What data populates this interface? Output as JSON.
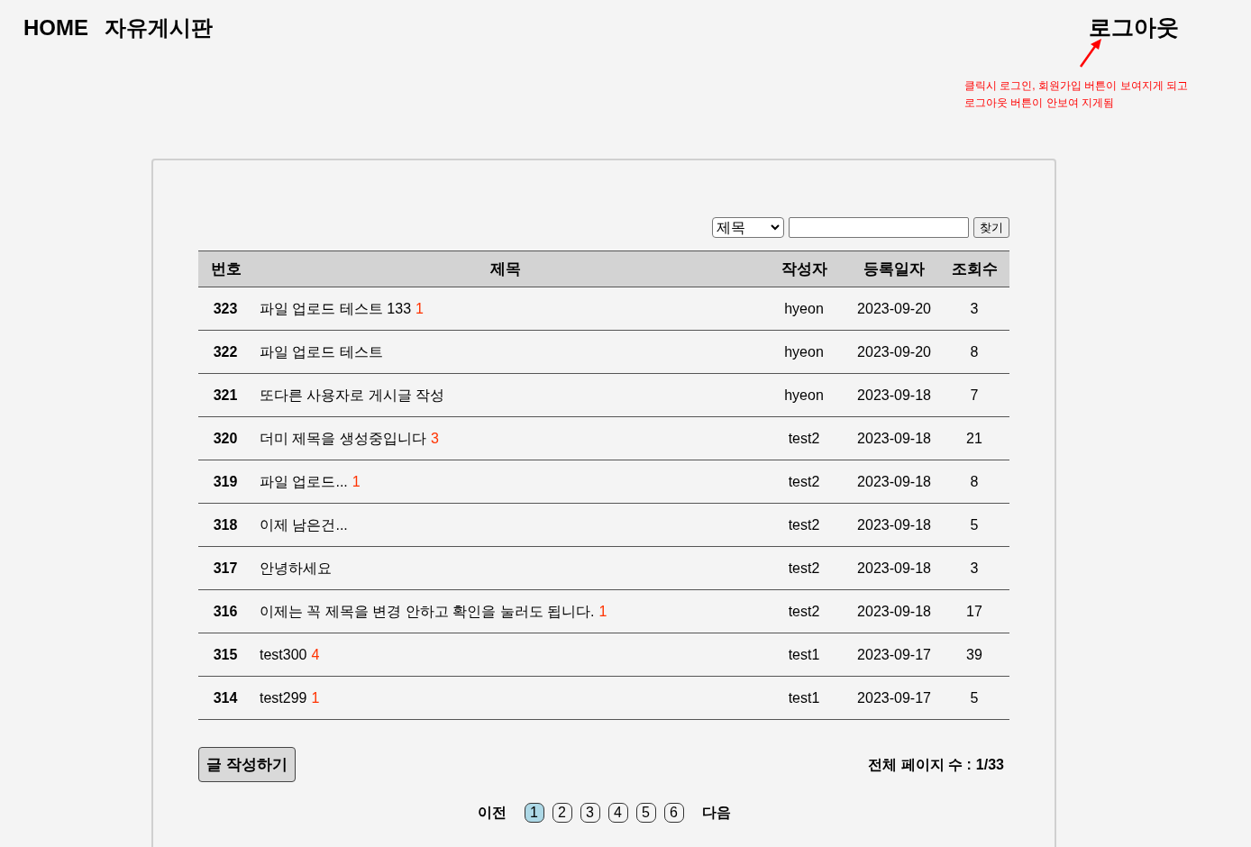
{
  "nav": {
    "home": "HOME",
    "board": "자유게시판",
    "logout": "로그아웃"
  },
  "annotation": {
    "lines": [
      "클릭시 로그인, 회원가입 버튼이 보여지게 되고",
      "로그아웃 버튼이 안보여 지게됨"
    ]
  },
  "search": {
    "option": "제목",
    "button": "찾기"
  },
  "table": {
    "columns": [
      "번호",
      "제목",
      "작성자",
      "등록일자",
      "조회수"
    ],
    "rows": [
      {
        "no": "323",
        "title": {
          "text": "파일 업로드 테스트 133",
          "comments": "1"
        },
        "author": "hyeon",
        "date": "2023-09-20",
        "views": "3"
      },
      {
        "no": "322",
        "title": {
          "text": "파일 업로드 테스트"
        },
        "author": "hyeon",
        "date": "2023-09-20",
        "views": "8"
      },
      {
        "no": "321",
        "title": {
          "text": "또다른 사용자로 게시글 작성"
        },
        "author": "hyeon",
        "date": "2023-09-18",
        "views": "7"
      },
      {
        "no": "320",
        "title": {
          "text": "더미 제목을 생성중입니다",
          "comments": "3"
        },
        "author": "test2",
        "date": "2023-09-18",
        "views": "21"
      },
      {
        "no": "319",
        "title": {
          "text": "파일 업로드...",
          "comments": "1"
        },
        "author": "test2",
        "date": "2023-09-18",
        "views": "8"
      },
      {
        "no": "318",
        "title": {
          "text": "이제 남은건..."
        },
        "author": "test2",
        "date": "2023-09-18",
        "views": "5"
      },
      {
        "no": "317",
        "title": {
          "text": "안녕하세요"
        },
        "author": "test2",
        "date": "2023-09-18",
        "views": "3"
      },
      {
        "no": "316",
        "title": {
          "text": "이제는 꼭 제목을 변경 안하고 확인을 눌러도 됩니다.",
          "comments": "1"
        },
        "author": "test2",
        "date": "2023-09-18",
        "views": "17"
      },
      {
        "no": "315",
        "title": {
          "text": "test300",
          "comments": "4"
        },
        "author": "test1",
        "date": "2023-09-17",
        "views": "39"
      },
      {
        "no": "314",
        "title": {
          "text": "test299",
          "comments": "1"
        },
        "author": "test1",
        "date": "2023-09-17",
        "views": "5"
      }
    ]
  },
  "write_button": "글 작성하기",
  "page_info": {
    "label": "전체 페이지 수 :",
    "value": "1/33"
  },
  "pagination": {
    "prev": "이전",
    "next": "다음",
    "pages": [
      {
        "label": "1",
        "selected": true
      },
      {
        "label": "2",
        "selected": false
      },
      {
        "label": "3",
        "selected": false
      },
      {
        "label": "4",
        "selected": false
      },
      {
        "label": "5",
        "selected": false
      },
      {
        "label": "6",
        "selected": false
      }
    ]
  }
}
